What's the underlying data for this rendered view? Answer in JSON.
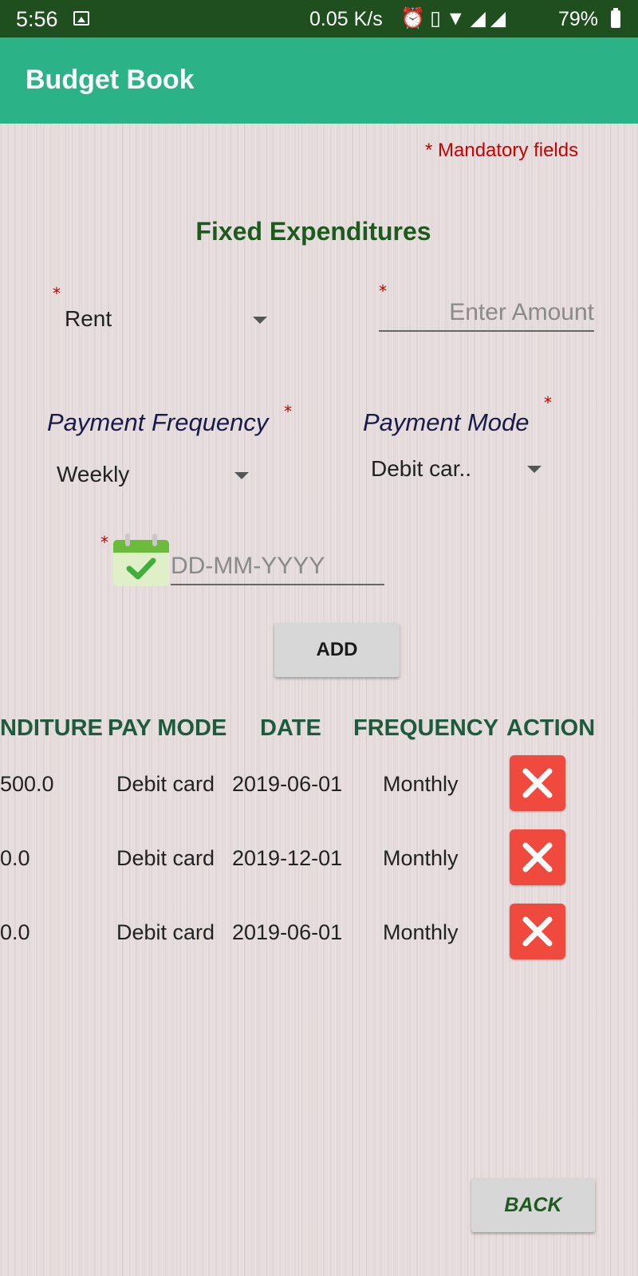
{
  "status_bar": {
    "time": "5:56",
    "network_speed": "0.05 K/s",
    "battery": "79%"
  },
  "app_bar": {
    "title": "Budget Book"
  },
  "form": {
    "mandatory_note": "* Mandatory fields",
    "required_marker": "*",
    "section_title": "Fixed Expenditures",
    "expense_type": "Rent",
    "amount_placeholder": "Enter Amount",
    "payment_frequency_label": "Payment Frequency",
    "payment_frequency_value": "Weekly",
    "payment_mode_label": "Payment Mode",
    "payment_mode_value": "Debit car..",
    "date_placeholder": "DD-MM-YYYY",
    "add_label": "ADD"
  },
  "table": {
    "headers": [
      "NDITURE",
      "PAY MODE",
      "DATE",
      "FREQUENCY",
      "ACTION"
    ],
    "rows": [
      {
        "expenditure": "500.0",
        "pay_mode": "Debit card",
        "date": "2019-06-01",
        "frequency": "Monthly"
      },
      {
        "expenditure": "0.0",
        "pay_mode": "Debit card",
        "date": "2019-12-01",
        "frequency": "Monthly"
      },
      {
        "expenditure": "0.0",
        "pay_mode": "Debit card",
        "date": "2019-06-01",
        "frequency": "Monthly"
      }
    ]
  },
  "back_label": "BACK",
  "colors": {
    "status_bar": "#1f4f1f",
    "app_bar": "#2cb287",
    "section_title": "#1e5a1e",
    "required": "#cc0000",
    "delete_button": "#f04a3e",
    "button": "#d7d7d7"
  },
  "icons": [
    "image-icon",
    "alarm-icon",
    "vibrate-icon",
    "wifi-icon",
    "signal-icon",
    "battery-icon",
    "calendar-icon",
    "delete-icon"
  ]
}
